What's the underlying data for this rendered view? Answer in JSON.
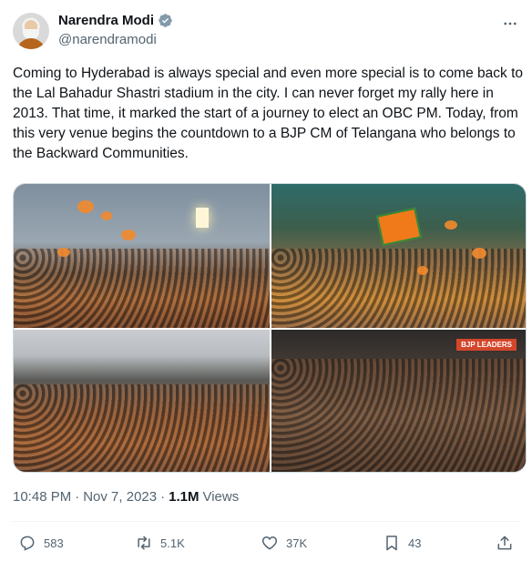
{
  "author": {
    "display_name": "Narendra Modi",
    "handle": "@narendramodi",
    "verified": true,
    "verified_color": "#829aab"
  },
  "tweet": {
    "text": "Coming to Hyderabad is always special and even more special is to come back to the Lal Bahadur Shastri stadium in the city. I can never forget my rally here in 2013. That time, it marked the start of a journey to elect an OBC PM. Today, from this very venue begins the countdown to a BJP CM of Telangana who belongs to the Backward Communities.",
    "media_count": 4,
    "photo4_badge": "BJP LEADERS"
  },
  "meta": {
    "time": "10:48 PM",
    "separator": "·",
    "date": "Nov 7, 2023",
    "views_count": "1.1M",
    "views_label": "Views"
  },
  "actions": {
    "replies": "583",
    "reposts": "5.1K",
    "likes": "37K",
    "bookmarks": "43"
  },
  "colors": {
    "text_primary": "#0f1419",
    "text_secondary": "#536471",
    "divider": "#eff3f4"
  }
}
